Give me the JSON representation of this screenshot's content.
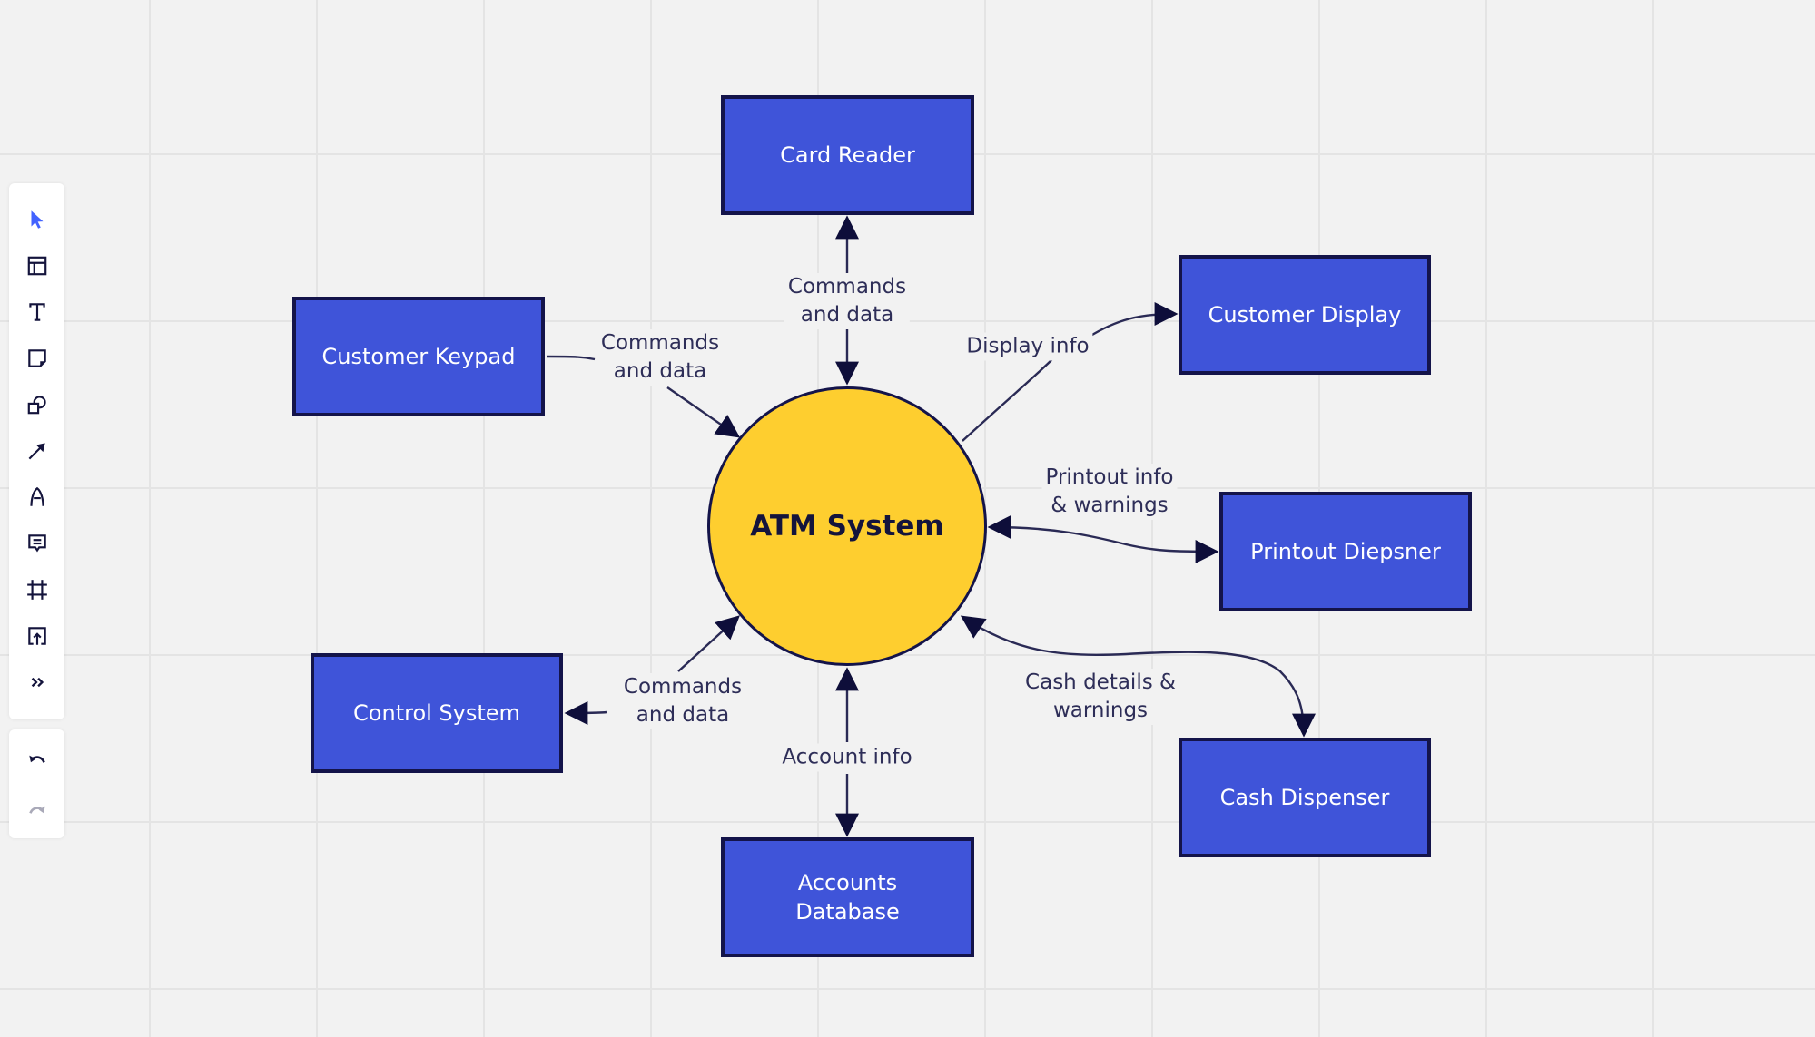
{
  "toolbar": {
    "tools": [
      {
        "name": "select-tool",
        "icon": "pointer-icon",
        "active": true
      },
      {
        "name": "templates-tool",
        "icon": "layout-template-icon",
        "active": false
      },
      {
        "name": "text-tool",
        "icon": "text-icon",
        "active": false
      },
      {
        "name": "sticky-note-tool",
        "icon": "sticky-note-icon",
        "active": false
      },
      {
        "name": "shapes-tool",
        "icon": "shapes-icon",
        "active": false
      },
      {
        "name": "connection-line-tool",
        "icon": "arrow-line-icon",
        "active": false
      },
      {
        "name": "pen-tool",
        "icon": "pen-icon",
        "active": false
      },
      {
        "name": "comment-tool",
        "icon": "comment-icon",
        "active": false
      },
      {
        "name": "frame-tool",
        "icon": "frame-icon",
        "active": false
      },
      {
        "name": "upload-tool",
        "icon": "upload-icon",
        "active": false
      },
      {
        "name": "more-tools",
        "icon": "double-chevron-right-icon",
        "active": false
      }
    ],
    "history": [
      {
        "name": "undo-button",
        "icon": "undo-icon",
        "enabled": true
      },
      {
        "name": "redo-button",
        "icon": "redo-icon",
        "enabled": false
      }
    ]
  },
  "colors": {
    "canvas": "#f2f2f2",
    "entity_fill": "#3f54d9",
    "entity_border": "#14144a",
    "process_fill": "#fece2f",
    "line": "#14143c",
    "accent": "#4262ff"
  },
  "diagram": {
    "process": {
      "label": "ATM System"
    },
    "entities": {
      "card_reader": "Card Reader",
      "customer_keypad": "Customer Keypad",
      "customer_display": "Customer Display",
      "printout_dispenser": "Printout Diepsner",
      "control_system": "Control System",
      "accounts_database": "Accounts\nDatabase",
      "cash_dispenser": "Cash Dispenser"
    },
    "flows": {
      "card_reader": "Commands\nand data",
      "customer_keypad": "Commands\nand data",
      "customer_display": "Display info",
      "printout_dispenser": "Printout info\n& warnings",
      "control_system": "Commands\nand data",
      "accounts_database": "Account info",
      "cash_dispenser": "Cash details &\nwarnings"
    }
  }
}
